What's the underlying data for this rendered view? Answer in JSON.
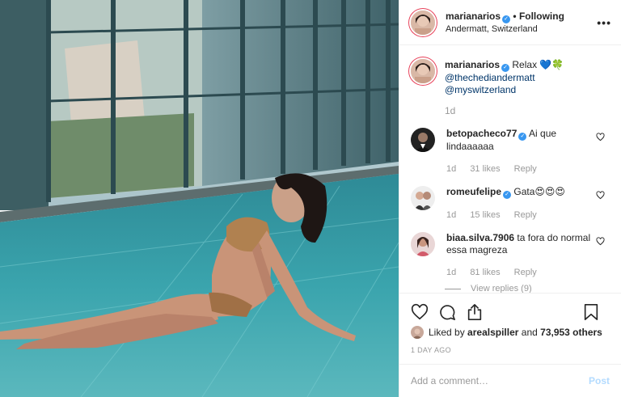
{
  "header": {
    "username": "marianarios",
    "separator": "•",
    "following_label": "Following",
    "location": "Andermatt, Switzerland",
    "more_icon": "ellipsis-icon"
  },
  "caption": {
    "username": "marianarios",
    "text": "Relax 💙🍀",
    "mentions": [
      "@thechediandermatt",
      "@myswitzerland"
    ],
    "time": "1d"
  },
  "comments": [
    {
      "username": "betopacheco77",
      "verified": true,
      "text": "Ai que lindaaaaaa",
      "time": "1d",
      "likes": "31 likes",
      "reply": "Reply"
    },
    {
      "username": "romeufelipe",
      "verified": true,
      "text": "Gata😍😍😍",
      "time": "1d",
      "likes": "15 likes",
      "reply": "Reply"
    },
    {
      "username": "biaa.silva.7906",
      "verified": false,
      "text": "ta fora do normal essa magreza",
      "time": "1d",
      "likes": "81 likes",
      "reply": "Reply",
      "view_replies": "View replies (9)"
    }
  ],
  "actions": {
    "like_icon": "heart-icon",
    "comment_icon": "comment-icon",
    "share_icon": "share-icon",
    "save_icon": "bookmark-icon"
  },
  "likes": {
    "prefix": "Liked by",
    "user": "arealspiller",
    "joiner": "and",
    "others": "73,953 others"
  },
  "timestamp": "1 DAY AGO",
  "add_comment": {
    "placeholder": "Add a comment…",
    "post_label": "Post"
  },
  "colors": {
    "link": "#003569",
    "verified": "#3897f0",
    "muted": "#999999",
    "post_disabled": "#b3dbff"
  }
}
